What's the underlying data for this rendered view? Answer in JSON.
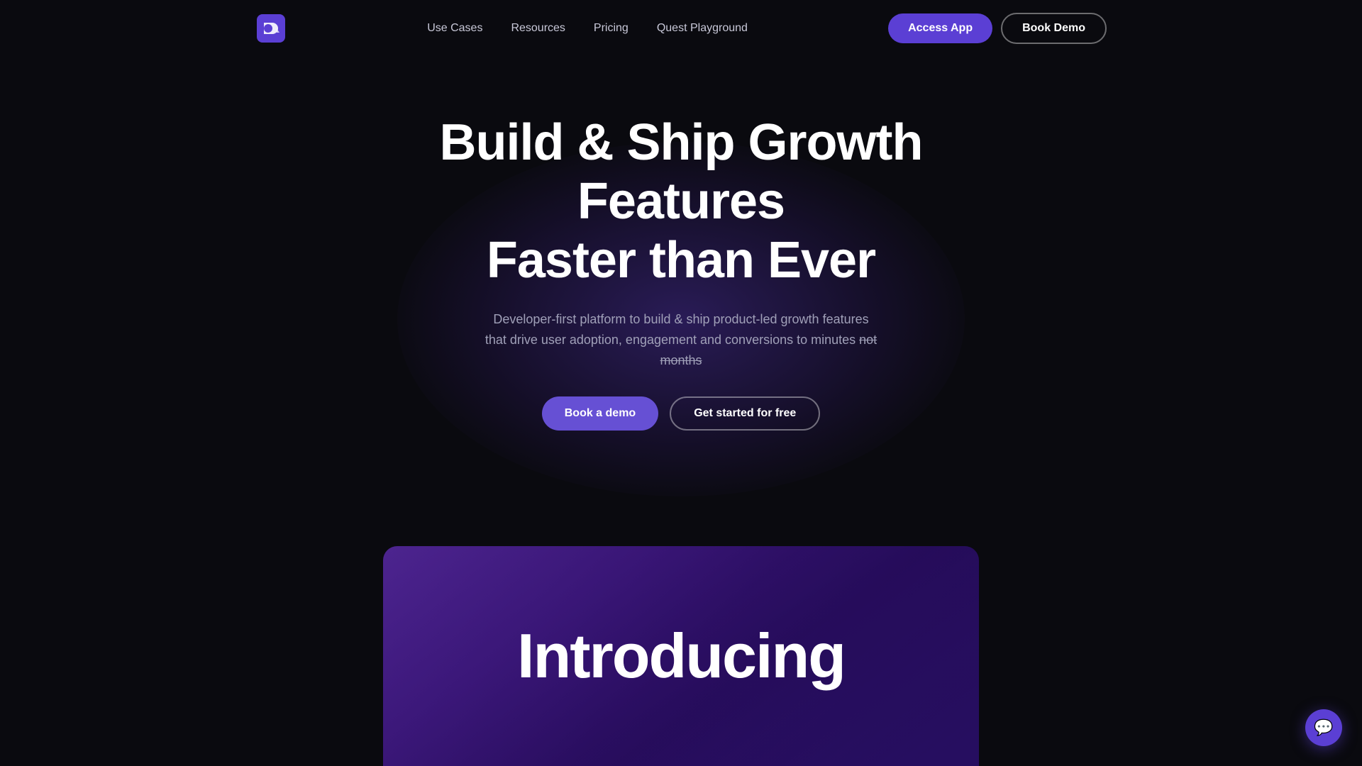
{
  "brand": {
    "logo_alt": "Quest Labs Logo"
  },
  "navbar": {
    "links": [
      {
        "label": "Use Cases",
        "id": "use-cases"
      },
      {
        "label": "Resources",
        "id": "resources"
      },
      {
        "label": "Pricing",
        "id": "pricing"
      },
      {
        "label": "Quest Playground",
        "id": "quest-playground"
      }
    ],
    "access_app_label": "Access App",
    "book_demo_label": "Book Demo"
  },
  "hero": {
    "title_line1": "Build & Ship Growth Features",
    "title_line2": "Faster than Ever",
    "subtitle_before": "Developer-first platform to build & ship product-led growth features that drive user adoption, engagement and conversions to minutes",
    "subtitle_strikethrough": "not months",
    "book_demo_label": "Book a demo",
    "get_started_label": "Get started for free"
  },
  "preview": {
    "introducing_text": "Introducing"
  },
  "chat": {
    "icon": "💬"
  },
  "colors": {
    "accent": "#5b3fd4",
    "bg": "#0a0a0f",
    "text_primary": "#ffffff",
    "text_secondary": "#a0a0b8"
  }
}
